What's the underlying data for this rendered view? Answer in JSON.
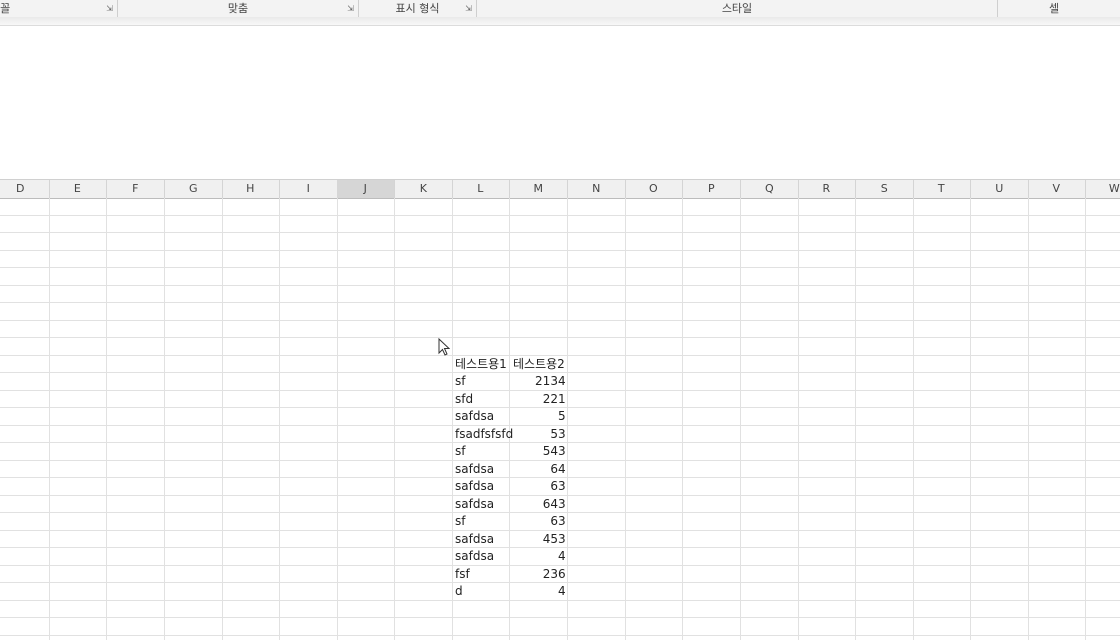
{
  "ribbon": {
    "groups": [
      {
        "label": "글꼴",
        "launcher": true
      },
      {
        "label": "맞춤",
        "launcher": true
      },
      {
        "label": "표시 형식",
        "launcher": true
      },
      {
        "label": "스타일",
        "launcher": false
      },
      {
        "label": "셀",
        "launcher": false
      }
    ]
  },
  "columns": [
    "D",
    "E",
    "F",
    "G",
    "H",
    "I",
    "J",
    "K",
    "L",
    "M",
    "N",
    "O",
    "P",
    "Q",
    "R",
    "S",
    "T",
    "U",
    "V",
    "W"
  ],
  "selected_column": "J",
  "table": {
    "headers": [
      "테스트용1",
      "테스트용2"
    ],
    "rows": [
      [
        "sf",
        "2134"
      ],
      [
        "sfd",
        "221"
      ],
      [
        "safdsa",
        "5"
      ],
      [
        "fsadfsfsfd",
        "53"
      ],
      [
        "sf",
        "543"
      ],
      [
        "safdsa",
        "64"
      ],
      [
        "safdsa",
        "63"
      ],
      [
        "safdsa",
        "643"
      ],
      [
        "sf",
        "63"
      ],
      [
        "safdsa",
        "453"
      ],
      [
        "safdsa",
        "4"
      ],
      [
        "fsf",
        "236"
      ],
      [
        "d",
        "4"
      ]
    ]
  },
  "icons": {
    "cursor": "arrow-cursor-icon",
    "launcher": "dialog-launcher-icon"
  }
}
